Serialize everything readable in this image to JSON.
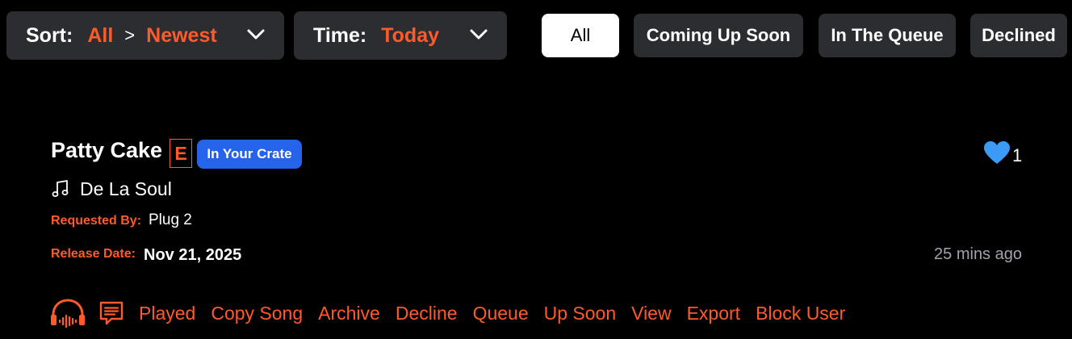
{
  "sort": {
    "label": "Sort:",
    "primary": "All",
    "separator": ">",
    "secondary": "Newest"
  },
  "time": {
    "label": "Time:",
    "value": "Today"
  },
  "filters": [
    "All",
    "Coming Up Soon",
    "In The Queue",
    "Declined"
  ],
  "active_filter": "All",
  "song": {
    "title": "Patty Cake",
    "explicit": "E",
    "badge": "In Your Crate",
    "artist": "De La Soul",
    "requested_by_label": "Requested By:",
    "requested_by": "Plug 2",
    "release_label": "Release Date:",
    "release_date": "Nov 21, 2025",
    "likes": "1",
    "time_ago": "25 mins ago"
  },
  "actions": [
    "Played",
    "Copy Song",
    "Archive",
    "Decline",
    "Queue",
    "Up Soon",
    "View",
    "Export",
    "Block User"
  ],
  "icons": {
    "chevron": "chevron-down-icon",
    "note": "music-note-icon",
    "heart": "heart-icon",
    "listen": "headphones-waveform-icon",
    "comment": "chat-bubble-icon"
  },
  "colors": {
    "accent": "#ff5a2a",
    "badge": "#2563eb",
    "heart": "#3b9bf5",
    "surface": "#2b2d31",
    "muted": "#a3a3b0"
  }
}
